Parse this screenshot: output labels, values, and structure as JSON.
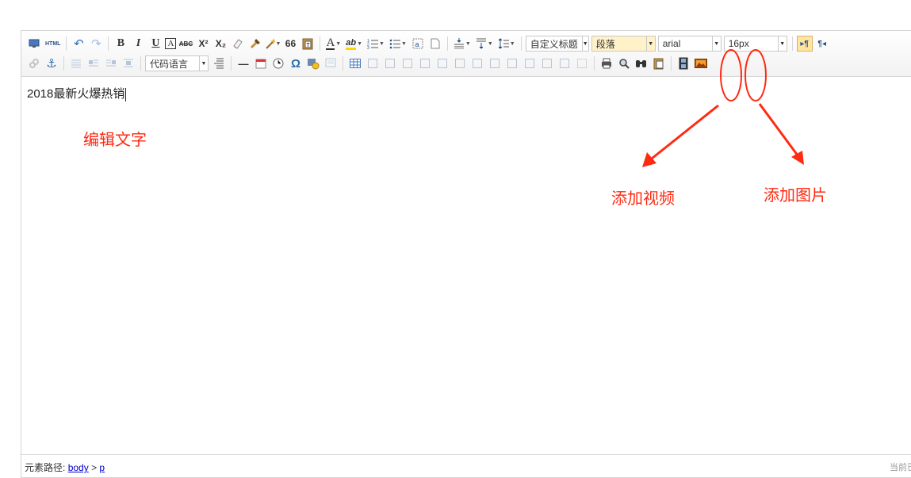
{
  "toolbar": {
    "html_label": "HTML",
    "bold": "B",
    "italic": "I",
    "underline": "U",
    "text_border": "A",
    "strike": "ABC",
    "superscript": "X²",
    "subscript": "X₂",
    "quote": "66",
    "font_color": "A",
    "backcolor": "ab",
    "custom_title_select": "自定义标题",
    "paragraph_select": "段落",
    "font_select": "arial",
    "size_select": "16px",
    "code_lang_select": "代码语言",
    "hr": "—",
    "special_char": "Ω"
  },
  "content": {
    "text": "2018最新火爆热销"
  },
  "statusbar": {
    "label": "元素路径:",
    "path_body": "body",
    "separator": ">",
    "path_p": "p",
    "right_text": "当前已"
  },
  "annotations": {
    "edit_text": "编辑文字",
    "add_video": "添加视频",
    "add_image": "添加图片",
    "color": "#ff2a12"
  }
}
